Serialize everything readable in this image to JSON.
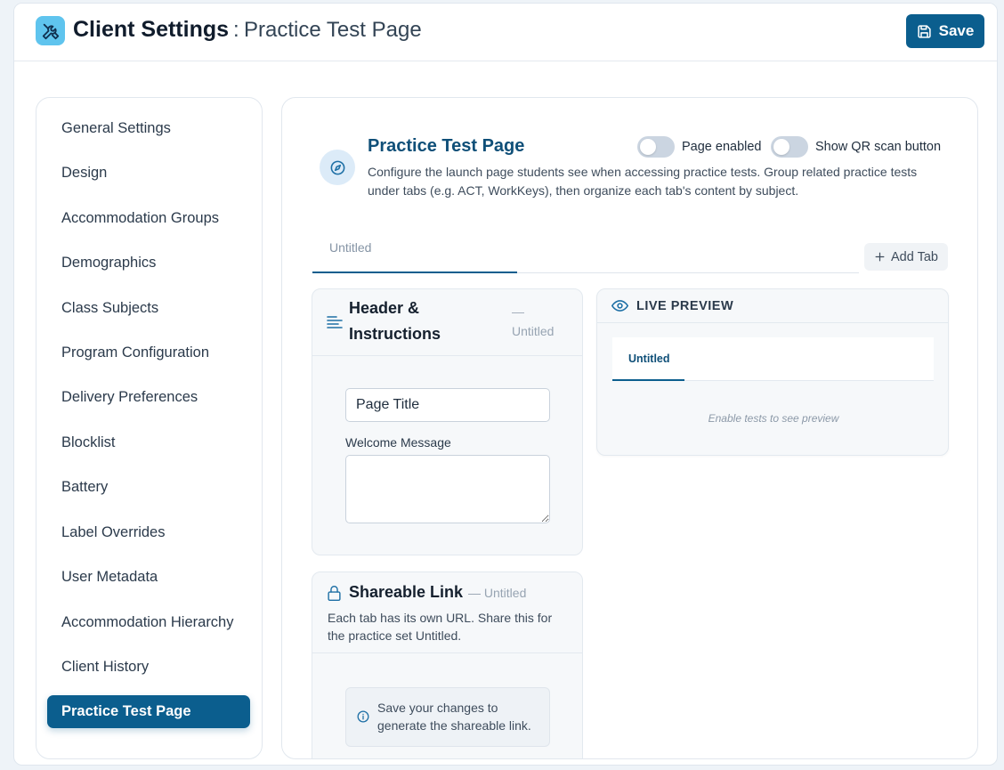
{
  "header": {
    "title": "Client Settings",
    "separator": ":",
    "subtitle": "Practice Test Page",
    "save_label": "Save"
  },
  "sidebar": {
    "items": [
      {
        "label": "General Settings",
        "active": false
      },
      {
        "label": "Design",
        "active": false
      },
      {
        "label": "Accommodation Groups",
        "active": false
      },
      {
        "label": "Demographics",
        "active": false
      },
      {
        "label": "Class Subjects",
        "active": false
      },
      {
        "label": "Program Configuration",
        "active": false
      },
      {
        "label": "Delivery Preferences",
        "active": false
      },
      {
        "label": "Blocklist",
        "active": false
      },
      {
        "label": "Battery",
        "active": false
      },
      {
        "label": "Label Overrides",
        "active": false
      },
      {
        "label": "User Metadata",
        "active": false
      },
      {
        "label": "Accommodation Hierarchy",
        "active": false
      },
      {
        "label": "Client History",
        "active": false
      },
      {
        "label": "Practice Test Page",
        "active": true
      }
    ]
  },
  "main": {
    "title": "Practice Test Page",
    "description": "Configure the launch page students see when accessing practice tests. Group related practice tests under tabs (e.g. ACT, WorkKeys), then organize each tab's content by subject.",
    "toggles": {
      "page_enabled": {
        "label": "Page enabled",
        "on": false
      },
      "qr_scan": {
        "label": "Show QR scan button",
        "on": false
      }
    },
    "tabs": [
      {
        "label": "Untitled",
        "active": true
      }
    ],
    "add_tab_label": "Add Tab"
  },
  "header_instructions": {
    "title": "Header & Instructions",
    "dash": "—",
    "tab_name": "Untitled",
    "page_title_value": "Page Title",
    "welcome_label": "Welcome Message",
    "welcome_value": ""
  },
  "shareable_link": {
    "title": "Shareable Link",
    "tab_name": "— Untitled",
    "description": "Each tab has its own URL. Share this for the practice set Untitled.",
    "notice": "Save your changes to generate the shareable link."
  },
  "live_preview": {
    "title": "LIVE PREVIEW",
    "tab_label": "Untitled",
    "empty_message": "Enable tests to see preview"
  },
  "colors": {
    "primary": "#0b5e8e",
    "app_icon_bg": "#5fc4ee",
    "title_color": "#0f4f78"
  },
  "icons": {
    "app": "tools-icon",
    "save": "floppy-disk-icon",
    "page": "compass-icon",
    "header_instructions": "align-left-icon",
    "shareable_link": "lock-icon",
    "notice": "info-icon",
    "live_preview": "eye-icon",
    "add_tab": "plus-icon"
  }
}
